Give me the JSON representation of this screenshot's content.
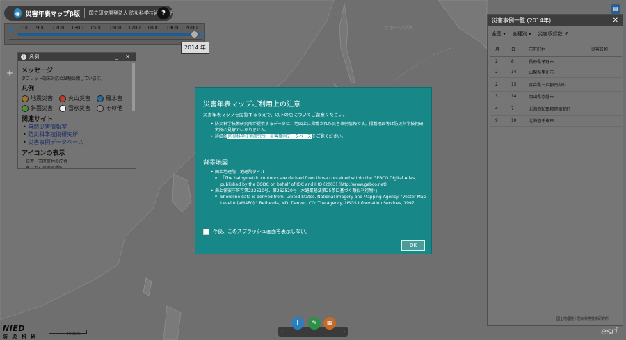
{
  "app": {
    "title": "災害年表マップβ版",
    "org": "国立研究開発法人 防災科学技術研究所",
    "help_label": "?"
  },
  "timeslider": {
    "ticks": [
      "700",
      "900",
      "1200",
      "1300",
      "1500",
      "1600",
      "1700",
      "1800",
      "1900",
      "2000"
    ],
    "current_year": "2014 年",
    "position_fraction": 0.97
  },
  "legend": {
    "title": "凡例",
    "message_heading": "メッセージ",
    "message_text": "タブレット端末対応の試験公開しています。",
    "legend_heading": "凡例",
    "items": [
      {
        "label": "地震災害",
        "color": "#a0742a"
      },
      {
        "label": "火山災害",
        "color": "#c43a2d"
      },
      {
        "label": "風水害",
        "color": "#2f6b9a"
      },
      {
        "label": "斜面災害",
        "color": "#4f8f3a"
      },
      {
        "label": "雪氷災害",
        "color": "#f2f2f2"
      },
      {
        "label": "その他",
        "color": "#8a8a8a"
      }
    ],
    "links_heading": "関連サイト",
    "links": [
      "自然災害情報室",
      "防災科学技術研究所",
      "災害事例データベース"
    ],
    "icon_heading": "アイコンの表示",
    "icon_items": [
      "位置：市区町村の庁舎",
      "色・形：災害の種別"
    ]
  },
  "map_labels": {
    "okhotsk": "オホーツク海",
    "scale": "400km"
  },
  "right_panel": {
    "title": "災害事例一覧 (2014年)",
    "filter_region": "全国",
    "filter_type": "全種別",
    "count_label": "災害収録数: 6",
    "columns": [
      "月",
      "日",
      "市区町村",
      "災害名称"
    ],
    "rows": [
      {
        "month": "2",
        "day": "8",
        "city": "長野県茅野市",
        "name": ""
      },
      {
        "month": "2",
        "day": "14",
        "city": "山梨県甲州市",
        "name": ""
      },
      {
        "month": "2",
        "day": "15",
        "city": "青森県三戸郡南部町",
        "name": ""
      },
      {
        "month": "3",
        "day": "14",
        "city": "岡山県赤磐市",
        "name": ""
      },
      {
        "month": "4",
        "day": "7",
        "city": "北海道虻田郡倶知安町",
        "name": ""
      },
      {
        "month": "9",
        "day": "10",
        "city": "北海道千歳市",
        "name": ""
      }
    ],
    "credit": "国土地理院｜防災科学技術研究所"
  },
  "modal": {
    "title": "災害年表マップご利用上の注意",
    "intro": "災害年表マップを閲覧するうえで、以下の点についてご留意ください。",
    "bullet1": "防災科学技術研究所が提供するデータは、地図上に掲載された災害事例情報です。掲載地図等は防災科学技術研究所の見解ではありません。",
    "bullet2_pre": "詳細は",
    "bullet2_link": "防災科学技術研究所　災害事例データベース",
    "bullet2_post": "をご覧ください。",
    "bg_heading": "背景地図",
    "bg1": "国土地理院　地理院タイル",
    "bg1_sub": "「The bathymetric contours are derived from those contained within the GEBCO Digital Atlas, published by the BODC on behalf of IOC and IHO (2003) (http://www.gebco.net)",
    "bg2": "海上保安庁許可第222510号、第262520号（水路業務法第25条に基づく類似刊行物）」",
    "bg2_sub": "Shoreline data is derived from: United States. National Imagery and Mapping Agency. \"Vector Map Level 0 (VMAP0).\" Bethesda, MD: Denver, CO: The Agency; USGS Information Services, 1997.",
    "checkbox_label": "今後、このスプラッシュ画面を表示しない。",
    "ok_label": "OK"
  },
  "footer": {
    "logo_main": "NIED",
    "logo_sub": "防 災 科 研",
    "esri": "esri"
  }
}
